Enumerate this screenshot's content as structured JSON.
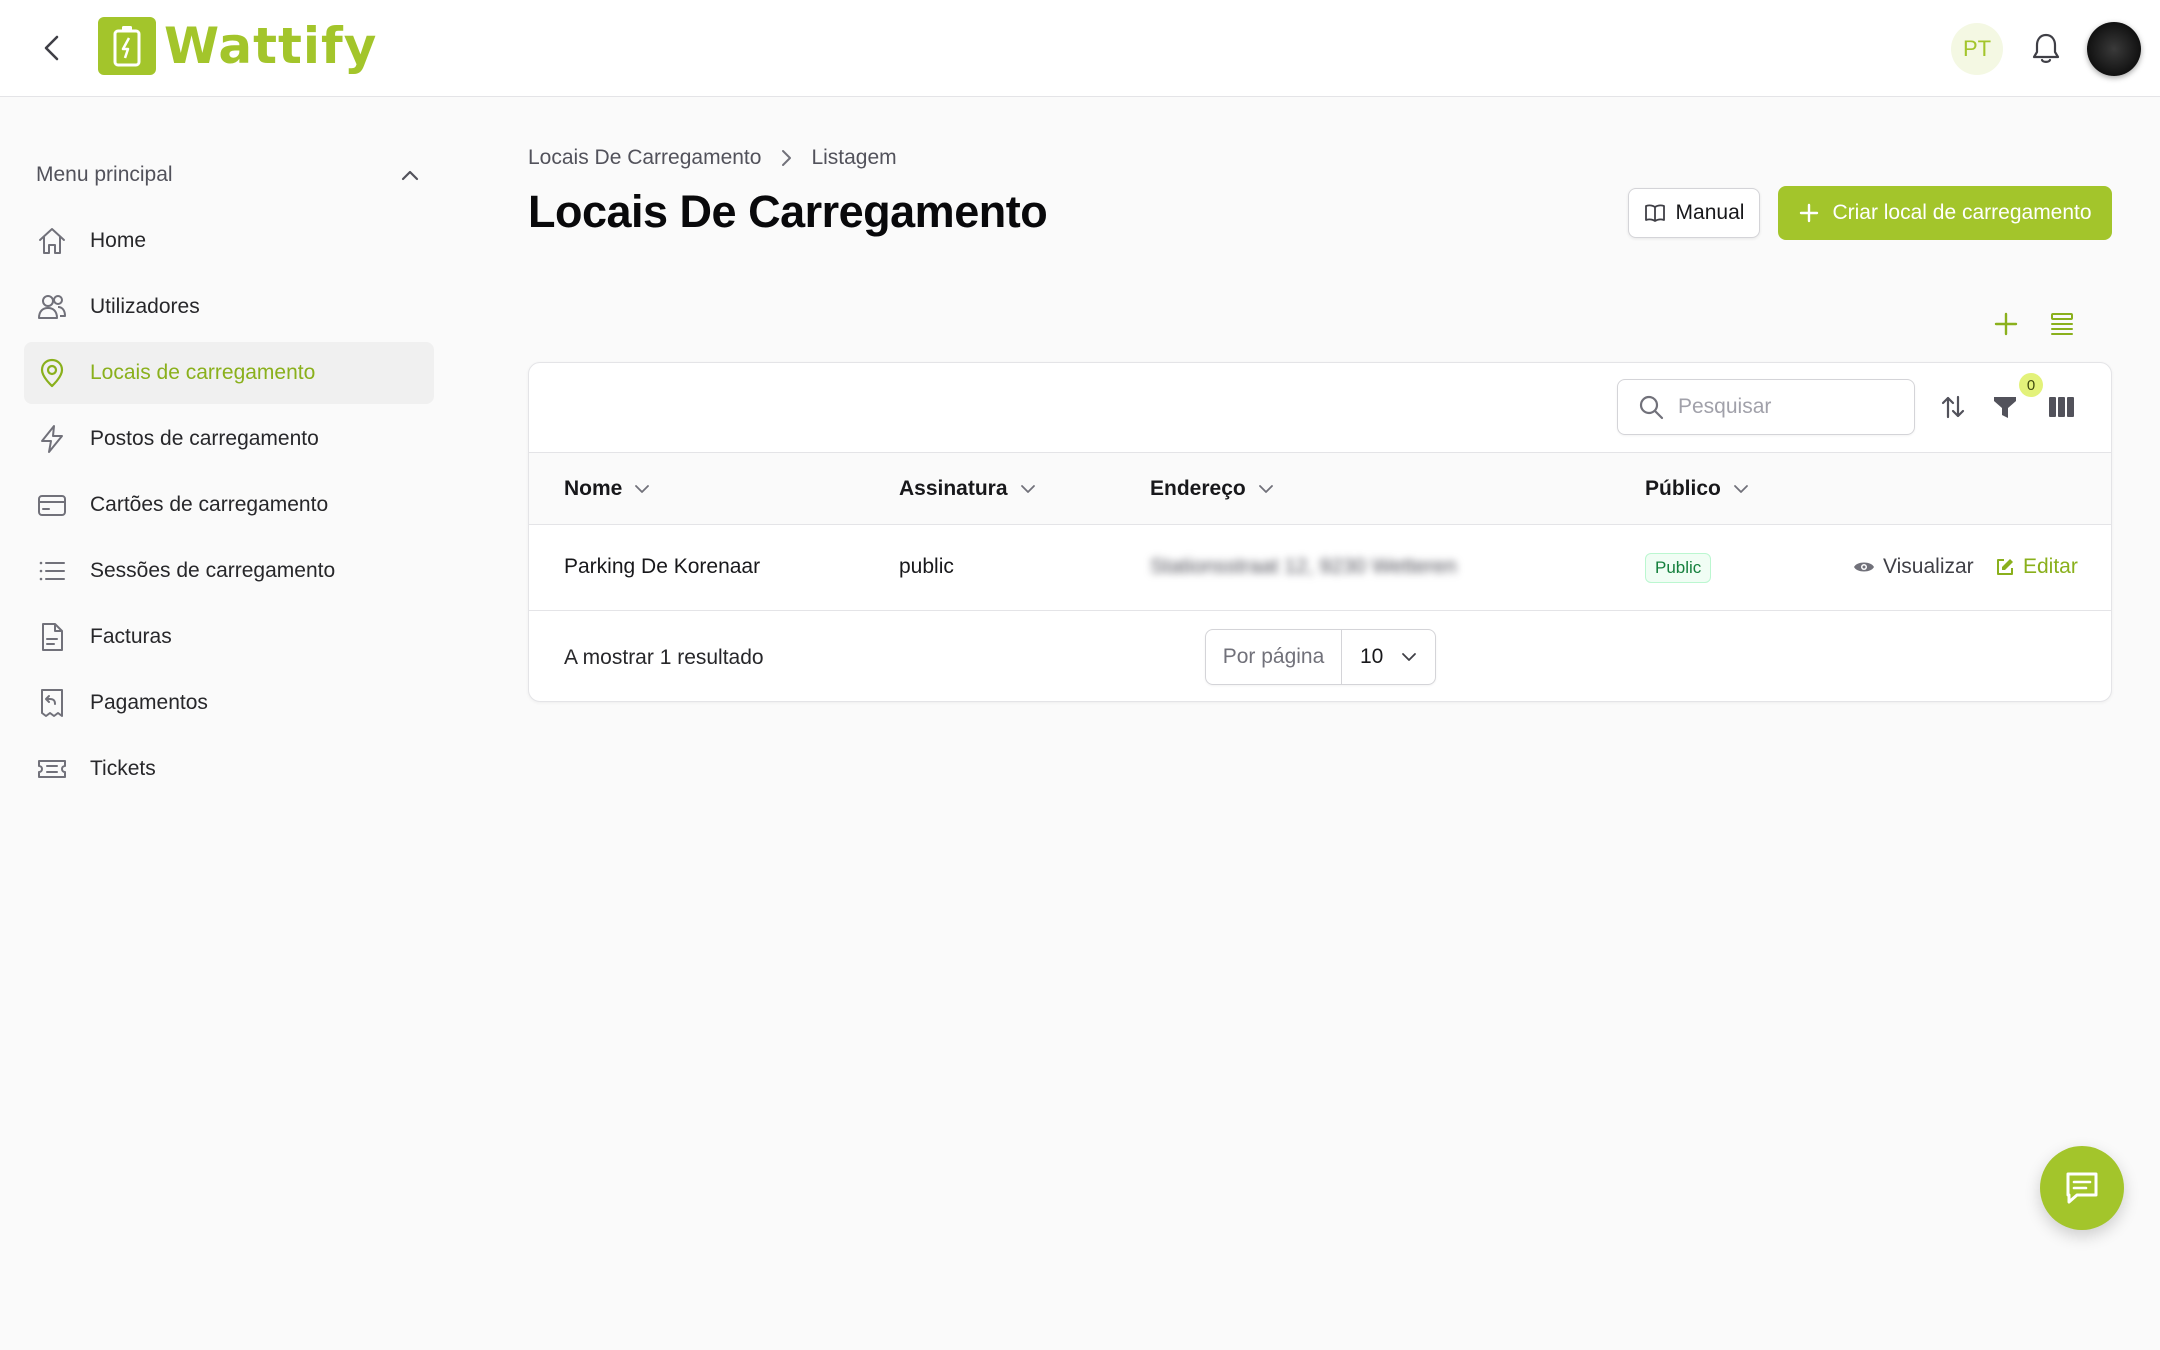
{
  "header": {
    "app_name": "Wattify",
    "language": "PT"
  },
  "sidebar": {
    "section_title": "Menu principal",
    "items": [
      {
        "label": "Home",
        "icon": "home-icon"
      },
      {
        "label": "Utilizadores",
        "icon": "users-icon"
      },
      {
        "label": "Locais de carregamento",
        "icon": "map-pin-icon",
        "active": true
      },
      {
        "label": "Postos de carregamento",
        "icon": "bolt-icon"
      },
      {
        "label": "Cartões de carregamento",
        "icon": "credit-card-icon"
      },
      {
        "label": "Sessões de carregamento",
        "icon": "list-icon"
      },
      {
        "label": "Facturas",
        "icon": "document-icon"
      },
      {
        "label": "Pagamentos",
        "icon": "receipt-refund-icon"
      },
      {
        "label": "Tickets",
        "icon": "ticket-icon"
      }
    ]
  },
  "breadcrumb": {
    "parent": "Locais De Carregamento",
    "current": "Listagem"
  },
  "page": {
    "title": "Locais De Carregamento",
    "manual_label": "Manual",
    "create_label": "Criar local de carregamento"
  },
  "table": {
    "search_placeholder": "Pesquisar",
    "filter_count": "0",
    "columns": [
      "Nome",
      "Assinatura",
      "Endereço",
      "Público"
    ],
    "rows": [
      {
        "nome": "Parking De Korenaar",
        "assinatura": "public",
        "endereco": "Stationsstraat 12, 9230 Wetteren",
        "publico": "Public",
        "view_label": "Visualizar",
        "edit_label": "Editar"
      }
    ],
    "result_text": "A mostrar 1 resultado",
    "per_page_label": "Por página",
    "per_page_value": "10"
  },
  "colors": {
    "accent": "#a3c52b",
    "accent_text": "#8ab01c",
    "badge_green": "#15803d"
  }
}
